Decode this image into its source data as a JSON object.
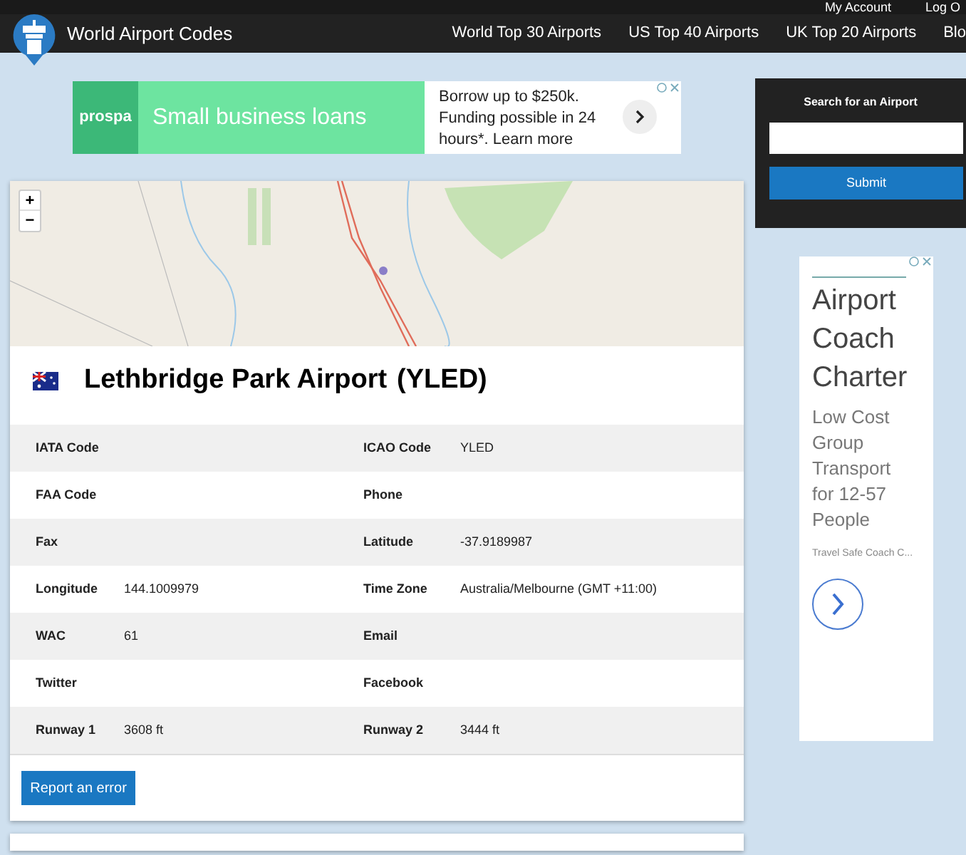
{
  "top_strip": {
    "links": [
      "My Account",
      "Log O"
    ]
  },
  "header": {
    "site_title": "World Airport Codes",
    "nav": [
      "World Top 30 Airports",
      "US Top 40 Airports",
      "UK Top 20 Airports",
      "Blo"
    ]
  },
  "banner_ad": {
    "brand": "prospa",
    "headline": "Small business loans",
    "body": "Borrow up to $250k. Funding possible in 24 hours*. Learn more"
  },
  "map": {
    "zoom_in": "+",
    "zoom_out": "−"
  },
  "airport": {
    "name": "Lethbridge Park Airport",
    "code": "(YLED)"
  },
  "details": [
    {
      "label_1": "IATA Code",
      "label_2": "ICAO Code",
      "value_2": "YLED"
    },
    {
      "label_1": "FAA Code",
      "label_2": "Phone"
    },
    {
      "label_1": "Fax",
      "label_2": "Latitude",
      "value_2": "-37.9189987"
    },
    {
      "label_1": "Longitude",
      "value_1": "144.1009979",
      "label_2": "Time Zone",
      "value_2": "Australia/Melbourne (GMT +11:00)"
    },
    {
      "label_1": "WAC",
      "value_1": "61",
      "label_2": "Email"
    },
    {
      "label_1": "Twitter",
      "label_2": "Facebook"
    },
    {
      "label_1": "Runway 1",
      "value_1": "3608 ft",
      "label_2": "Runway 2",
      "value_2": "3444 ft"
    }
  ],
  "report_button": "Report an error",
  "search": {
    "title": "Search for an Airport",
    "button": "Submit"
  },
  "side_ad": {
    "headline": "Airport Coach Charter",
    "body": "Low Cost Group Transport for 12-57 People",
    "source": "Travel Safe Coach C..."
  }
}
